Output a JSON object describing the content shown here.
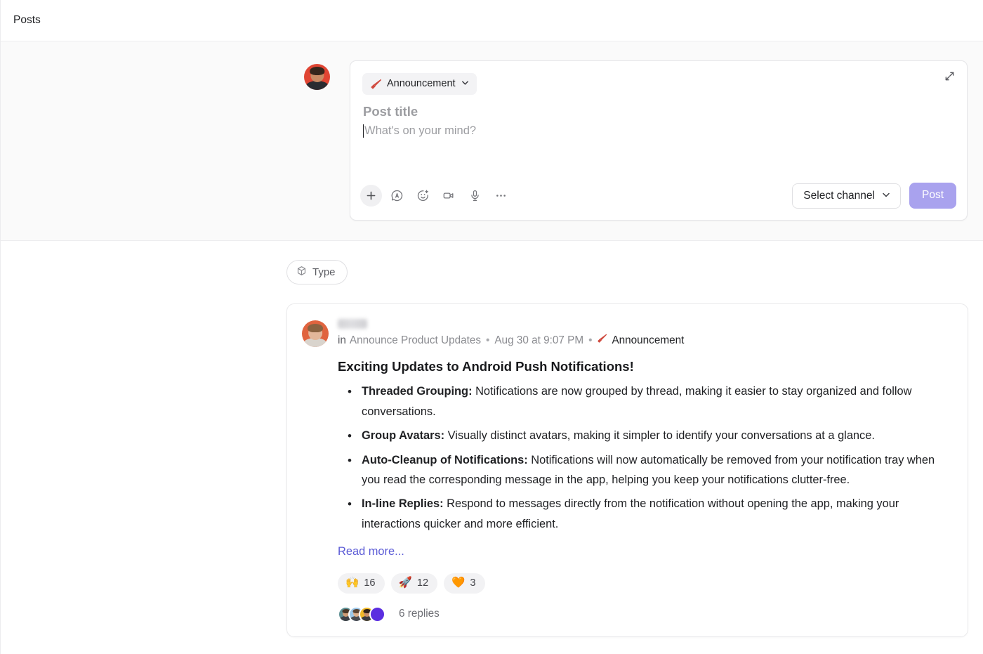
{
  "header": {
    "title": "Posts"
  },
  "composer": {
    "type_chip": {
      "label": "Announcement",
      "icon": "megaphone-icon",
      "chevron": "chevron-down-icon"
    },
    "expand_icon": "expand-icon",
    "title_placeholder": "Post title",
    "body_placeholder": "What's on your mind?",
    "tools": [
      {
        "name": "add-attachment-icon",
        "label": "Add"
      },
      {
        "name": "text-format-icon",
        "label": "Formatting"
      },
      {
        "name": "emoji-icon",
        "label": "Emoji"
      },
      {
        "name": "video-icon",
        "label": "Video clip"
      },
      {
        "name": "microphone-icon",
        "label": "Audio clip"
      },
      {
        "name": "more-options-icon",
        "label": "More"
      }
    ],
    "channel_select": {
      "label": "Select channel",
      "chevron": "chevron-down-icon"
    },
    "post_button": {
      "label": "Post",
      "color": "#a9a2ee",
      "disabled": true
    }
  },
  "feed": {
    "filter": {
      "label": "Type",
      "icon": "cube-icon"
    },
    "post": {
      "author_name": "",
      "author_redacted": true,
      "meta": {
        "in_word": "in",
        "channel": "Announce Product Updates",
        "separator": "•",
        "timestamp": "Aug 30 at 9:07 PM",
        "tag": "Announcement",
        "tag_icon": "megaphone-icon",
        "tag_color": "#d04a3f"
      },
      "title": "Exciting Updates to Android Push Notifications!",
      "bullets": [
        {
          "lead": "Threaded Grouping:",
          "text": " Notifications are now grouped by thread, making it easier to stay organized and follow conversations."
        },
        {
          "lead": "Group Avatars:",
          "text": " Visually distinct avatars, making it simpler to identify your conversations at a glance."
        },
        {
          "lead": "Auto-Cleanup of Notifications:",
          "text": " Notifications will now automatically be removed from your notification tray when you read the corresponding message in the app, helping you keep your notifications clutter-free."
        },
        {
          "lead": "In-line Replies:",
          "text": " Respond to messages directly from the notification without opening the app, making your interactions quicker and more efficient."
        }
      ],
      "read_more": "Read more...",
      "read_more_color": "#5b5bd6",
      "reactions": [
        {
          "emoji": "🙌",
          "count": "16"
        },
        {
          "emoji": "🚀",
          "count": "12"
        },
        {
          "emoji": "🧡",
          "count": "3"
        }
      ],
      "replies": {
        "count_label": "6 replies",
        "avatars": [
          {
            "bg": "#5e8f93",
            "type": "photo"
          },
          {
            "bg": "#9dc7e8",
            "type": "photo"
          },
          {
            "bg": "#f0b828",
            "type": "photo"
          },
          {
            "bg": "#5b2ee0",
            "type": "solid"
          }
        ]
      }
    }
  }
}
